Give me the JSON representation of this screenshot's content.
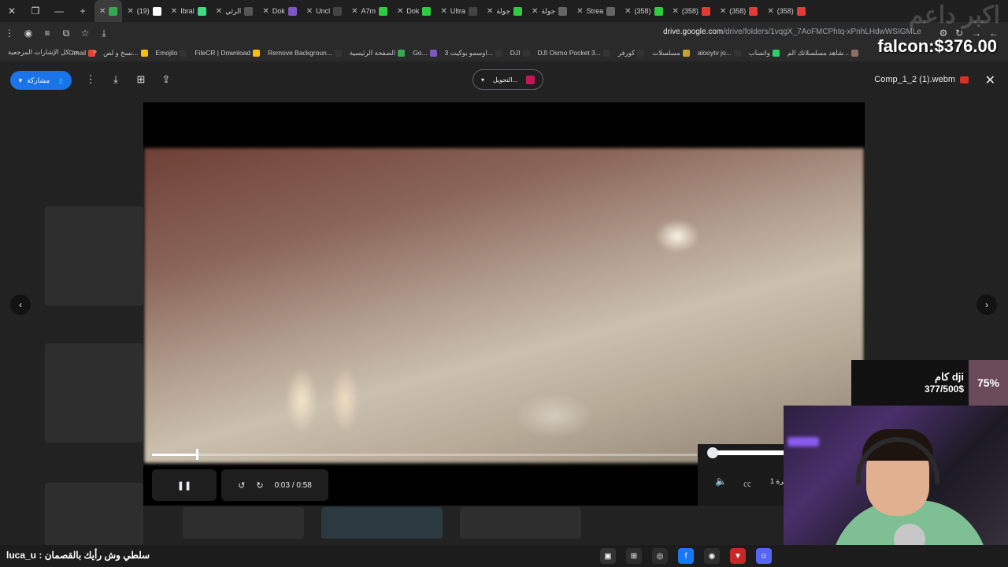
{
  "tabs": [
    {
      "label": "(19)",
      "color": "#ffffff"
    },
    {
      "label": "Ibral",
      "color": "#3ddc84"
    },
    {
      "label": "الرئي",
      "color": "#555"
    },
    {
      "label": "Dok",
      "color": "#7e57c2"
    },
    {
      "label": "Uncl",
      "color": "#444"
    },
    {
      "label": "A7m",
      "color": "#2ecc40"
    },
    {
      "label": "Dok",
      "color": "#2ecc40"
    },
    {
      "label": "Ultra",
      "color": "#444"
    },
    {
      "label": "جولة",
      "color": "#2ecc40"
    },
    {
      "label": "جولة",
      "color": "#666"
    },
    {
      "label": "Strea",
      "color": "#666"
    },
    {
      "label": "(358)",
      "color": "#2ecc40"
    },
    {
      "label": "(358)",
      "color": "#e53935"
    },
    {
      "label": "(358)",
      "color": "#e53935"
    },
    {
      "label": "(358)",
      "color": "#e53935"
    }
  ],
  "address": {
    "domain": "drive.google.com",
    "path": "/drive/folders/1vqgX_7AoFMCPhtq-xPnhLHdwWSIGMLe"
  },
  "bookmarks": [
    {
      "label": "Gmail",
      "color": "#ea4335"
    },
    {
      "label": "نسخ و لص...",
      "color": "#fbbc04"
    },
    {
      "label": "Emojilo",
      "color": "#333"
    },
    {
      "label": "FileCR | Download",
      "color": "#fbbc04"
    },
    {
      "label": "Remove Backgroun...",
      "color": "#333"
    },
    {
      "label": "الصفحة الرئيسية",
      "color": "#34a853"
    },
    {
      "label": "Go...",
      "color": "#7e57c2"
    },
    {
      "label": "اوسمو بوكيت 3...",
      "color": "#333"
    },
    {
      "label": "DJI",
      "color": "#333"
    },
    {
      "label": "DJI Osmo Pocket 3...",
      "color": "#333"
    },
    {
      "label": "كورفر",
      "color": "#333"
    },
    {
      "label": "مسلسلات",
      "color": "#c9a227"
    },
    {
      "label": "alooytv jo...",
      "color": "#333"
    },
    {
      "label": "واتساب",
      "color": "#25d366"
    },
    {
      "label": "شاهد مسلسلاتك الم...",
      "color": "#8d6e63"
    }
  ],
  "bookmarks_all": "كل الإشارات المرجعية",
  "toolbar": {
    "share_label": "مشاركة",
    "open_with_label": "التحويل..."
  },
  "file": {
    "title": "Comp_1_2 (1).webm"
  },
  "player": {
    "current_time": "0:03",
    "duration": "0:58",
    "time_display": "0:03 / 0:58",
    "progress_fraction": 0.083,
    "speed_label": "1 مرة"
  },
  "overlay": {
    "price": "falcon:$376.00",
    "watermark": "اكبر داعم"
  },
  "donation": {
    "name": "كام dji",
    "amount": "377/500$",
    "percent": "75%"
  },
  "taskbar": {
    "caption": "luca_u : سلطي وش رأيك بالقصمان"
  }
}
